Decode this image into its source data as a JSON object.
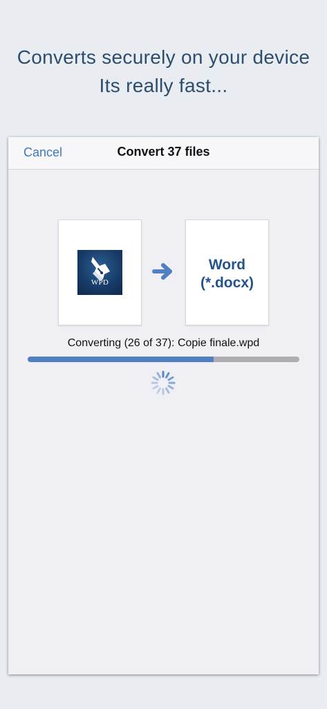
{
  "promo": {
    "line1": "Converts securely on your device",
    "line2": "Its really fast..."
  },
  "navbar": {
    "cancel_label": "Cancel",
    "title": "Convert 37 files"
  },
  "source_file": {
    "logo_text": "WPD",
    "icon": "fountain-pen-icon"
  },
  "conversion": {
    "arrow_icon": "right-arrow-icon",
    "target_line1": "Word",
    "target_line2": "(*.docx)",
    "status_text": "Converting (26 of 37): Copie finale.wpd",
    "current_file_number": 26,
    "total_files": 37,
    "progress_fraction": 0.684
  },
  "colors": {
    "promo_text": "#2d4d6e",
    "accent": "#3e7ab8",
    "progress_fill": "#4f80c2",
    "progress_track": "#aeaeb2",
    "target_text": "#24538c"
  }
}
